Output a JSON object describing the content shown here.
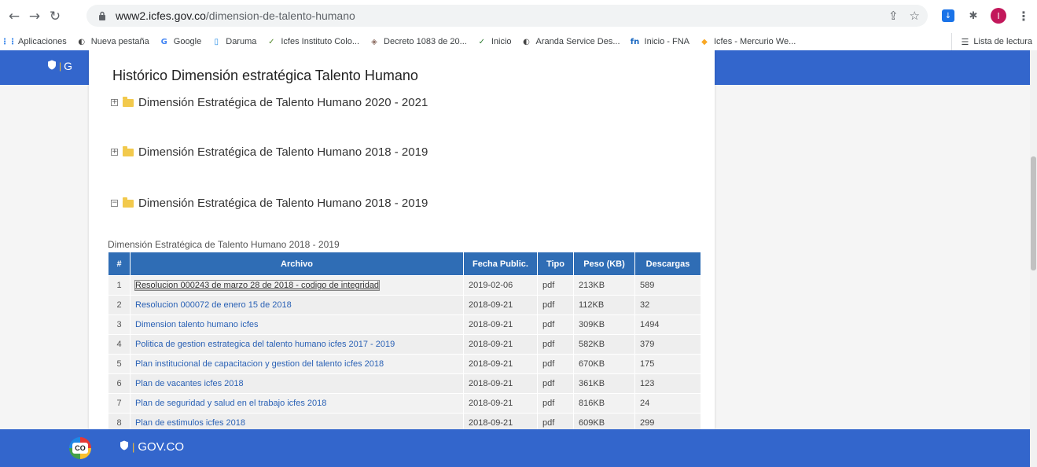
{
  "browser": {
    "nav": {
      "back_icon": "←",
      "forward_icon": "→",
      "reload_icon": "↻"
    },
    "url": {
      "host": "www2.icfes.gov.co",
      "path": "/dimension-de-talento-humano"
    },
    "omnibox_icons": {
      "share": "⇪",
      "star": "☆"
    },
    "profile_initial": "I"
  },
  "bookmarks": [
    {
      "label": "Aplicaciones",
      "icon": "apps-grid-icon",
      "glyph": "⋮⋮",
      "color": "#1a73e8"
    },
    {
      "label": "Nueva pestaña",
      "icon": "globe-icon",
      "glyph": "◐",
      "color": "#444444"
    },
    {
      "label": "Google",
      "icon": "google-icon",
      "glyph": "G",
      "color": "#4285f4"
    },
    {
      "label": "Daruma",
      "icon": "daruma-icon",
      "glyph": "▯",
      "color": "#1e88e5"
    },
    {
      "label": "Icfes Instituto Colo...",
      "icon": "icfes-icon",
      "glyph": "✓",
      "color": "#558b2f"
    },
    {
      "label": "Decreto 1083 de 20...",
      "icon": "shield-icon",
      "glyph": "◈",
      "color": "#8d6e63"
    },
    {
      "label": "Inicio",
      "icon": "icfes-icon",
      "glyph": "✓",
      "color": "#2e7d32"
    },
    {
      "label": "Aranda Service Des...",
      "icon": "globe-icon",
      "glyph": "◐",
      "color": "#444444"
    },
    {
      "label": "Inicio - FNA",
      "icon": "fna-icon",
      "glyph": "fn",
      "color": "#1565c0"
    },
    {
      "label": "Icfes - Mercurio We...",
      "icon": "mercurio-icon",
      "glyph": "◆",
      "color": "#f9a825"
    }
  ],
  "reading_list": "Lista de lectura",
  "page": {
    "header_logo": "GOV.CO",
    "title": "Histórico Dimensión estratégica Talento Humano",
    "sections": [
      {
        "label": "Dimensión Estratégica de Talento Humano 2020 - 2021",
        "toggle": "+",
        "state": "collapsed"
      },
      {
        "label": "Dimensión Estratégica de Talento Humano 2018 - 2019",
        "toggle": "+",
        "state": "collapsed"
      },
      {
        "label": "Dimensión Estratégica de Talento Humano 2018 - 2019",
        "toggle": "−",
        "state": "expanded"
      }
    ],
    "table_caption": "Dimensión Estratégica de Talento Humano 2018 - 2019",
    "table_headers": [
      "#",
      "Archivo",
      "Fecha Public.",
      "Tipo",
      "Peso (KB)",
      "Descargas"
    ],
    "rows": [
      {
        "n": "1",
        "archivo": "Resolucion 000243 de marzo 28 de 2018 - codigo de integridad",
        "fecha": "2019-02-06",
        "tipo": "pdf",
        "peso": "213KB",
        "descargas": "589"
      },
      {
        "n": "2",
        "archivo": "Resolucion 000072 de enero 15 de 2018",
        "fecha": "2018-09-21",
        "tipo": "pdf",
        "peso": "112KB",
        "descargas": "32"
      },
      {
        "n": "3",
        "archivo": "Dimension talento humano icfes",
        "fecha": "2018-09-21",
        "tipo": "pdf",
        "peso": "309KB",
        "descargas": "1494"
      },
      {
        "n": "4",
        "archivo": "Politica de gestion estrategica del talento humano icfes 2017 - 2019",
        "fecha": "2018-09-21",
        "tipo": "pdf",
        "peso": "582KB",
        "descargas": "379"
      },
      {
        "n": "5",
        "archivo": "Plan institucional de capacitacion y gestion del talento icfes 2018",
        "fecha": "2018-09-21",
        "tipo": "pdf",
        "peso": "670KB",
        "descargas": "175"
      },
      {
        "n": "6",
        "archivo": "Plan de vacantes icfes 2018",
        "fecha": "2018-09-21",
        "tipo": "pdf",
        "peso": "361KB",
        "descargas": "123"
      },
      {
        "n": "7",
        "archivo": "Plan de seguridad y salud en el trabajo icfes 2018",
        "fecha": "2018-09-21",
        "tipo": "pdf",
        "peso": "816KB",
        "descargas": "24"
      },
      {
        "n": "8",
        "archivo": "Plan de estimulos icfes 2018",
        "fecha": "2018-09-21",
        "tipo": "pdf",
        "peso": "609KB",
        "descargas": "299"
      }
    ],
    "footer": {
      "co_logo": "CO",
      "gov_label": "GOV.CO"
    }
  }
}
